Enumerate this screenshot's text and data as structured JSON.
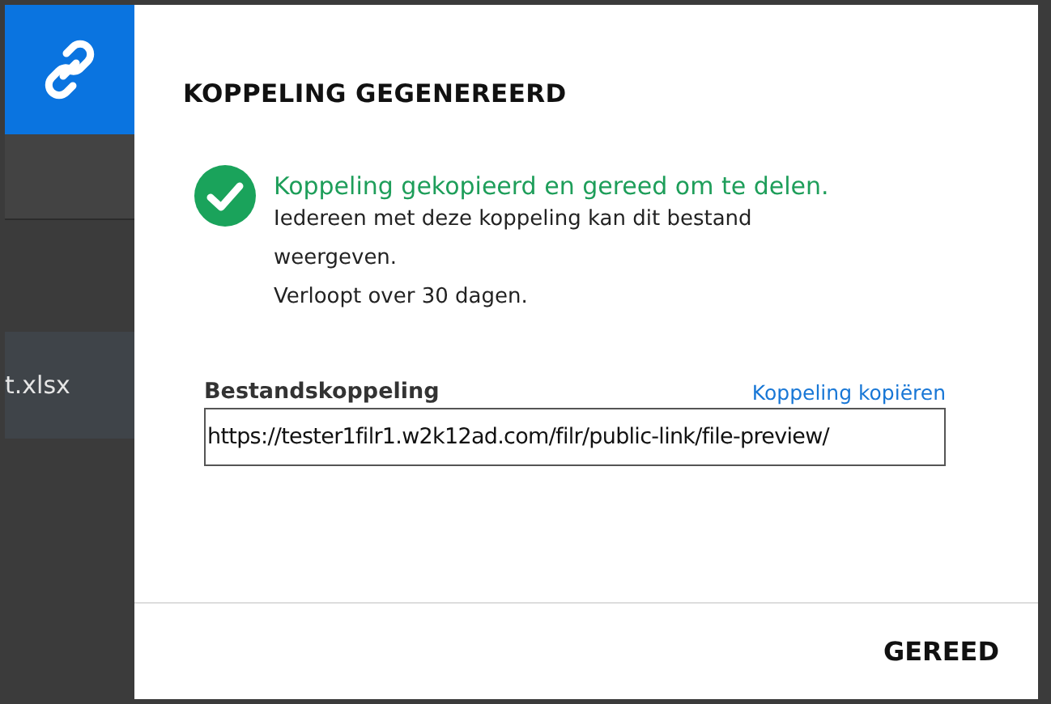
{
  "background": {
    "file_name": "t.xlsx"
  },
  "dialog": {
    "title": "KOPPELING GEGENEREERD",
    "status": {
      "kind": "success",
      "message": "Koppeling gekopieerd en gereed om te delen.",
      "details": [
        "Iedereen met deze koppeling kan dit bestand weergeven.",
        "Verloopt over 30 dagen."
      ]
    },
    "link_field": {
      "label": "Bestandskoppeling",
      "copy_link": "Koppeling kopiëren",
      "value": "https://tester1filr1.w2k12ad.com/filr/public-link/file-preview/"
    },
    "buttons": [
      "GEREED"
    ]
  }
}
